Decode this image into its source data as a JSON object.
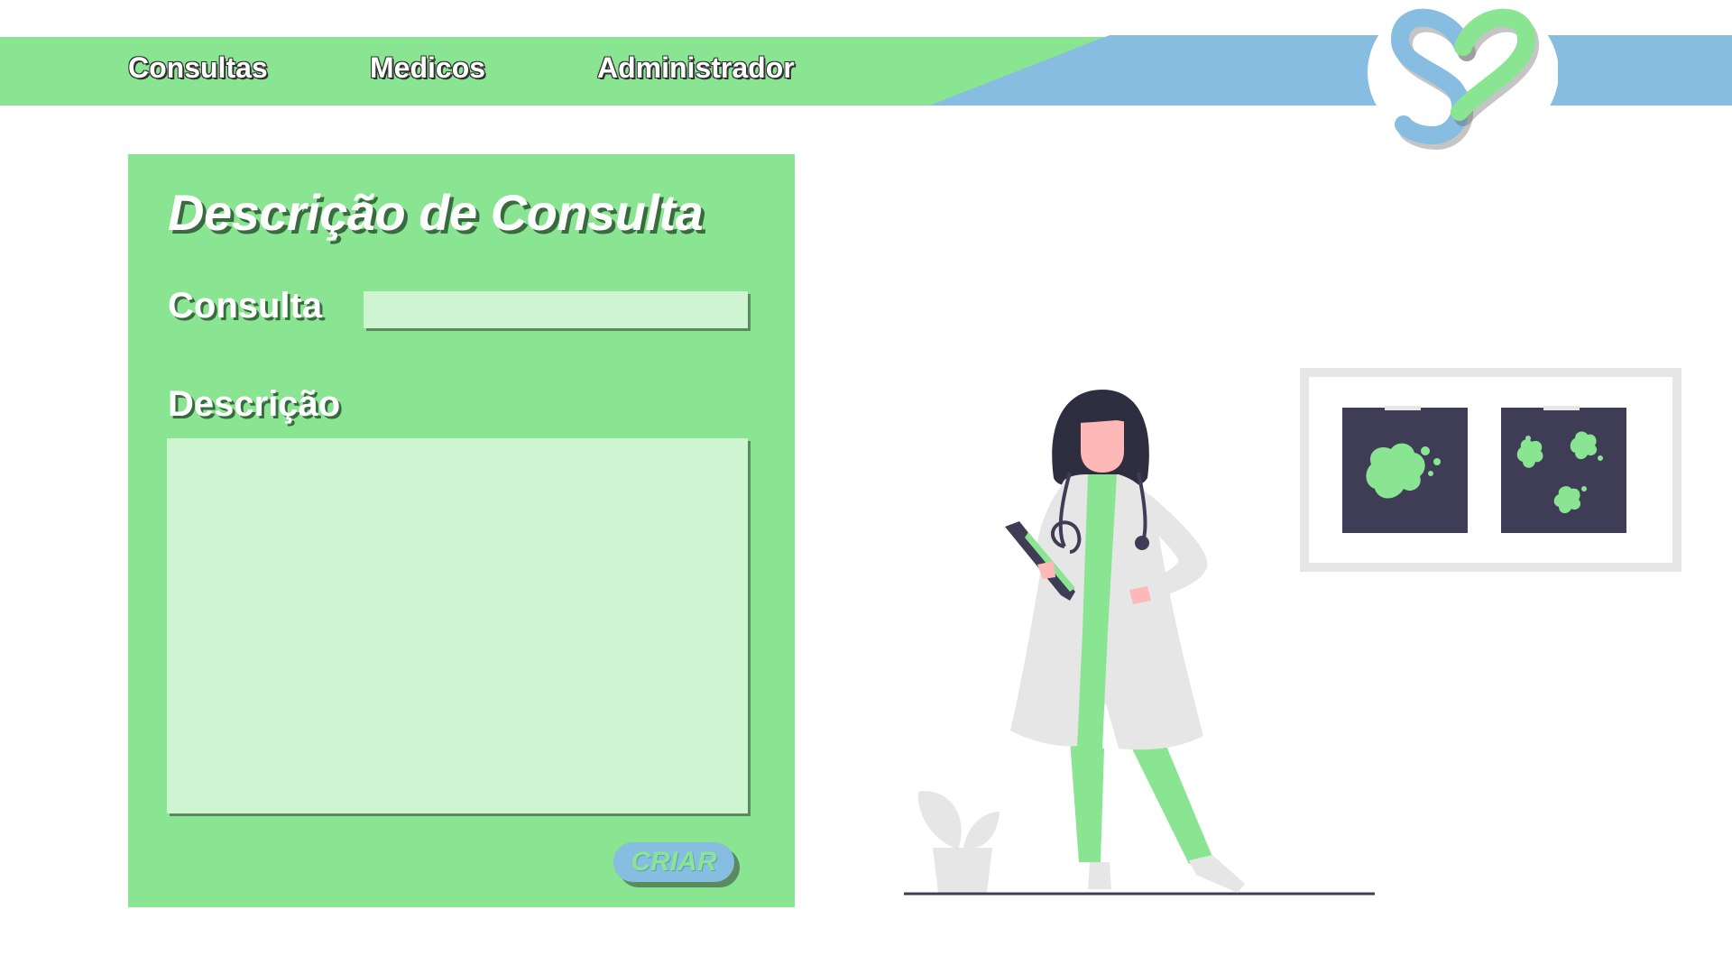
{
  "nav": {
    "items": [
      {
        "label": "Consultas"
      },
      {
        "label": "Medicos"
      },
      {
        "label": "Administrador"
      }
    ]
  },
  "logo": {
    "icon": "heart-s-logo-icon"
  },
  "form": {
    "title": "Descrição de  Consulta",
    "consulta_label": "Consulta",
    "consulta_value": "",
    "descricao_label": "Descrição",
    "descricao_value": "",
    "submit_label": "CRIAR"
  },
  "illustration": {
    "icon": "doctor-with-xray-illustration"
  },
  "colors": {
    "green": "#89e592",
    "light_green": "#cff4d2",
    "blue": "#86bde0",
    "dark": "#3f3d56",
    "gray": "#e6e6e6"
  }
}
